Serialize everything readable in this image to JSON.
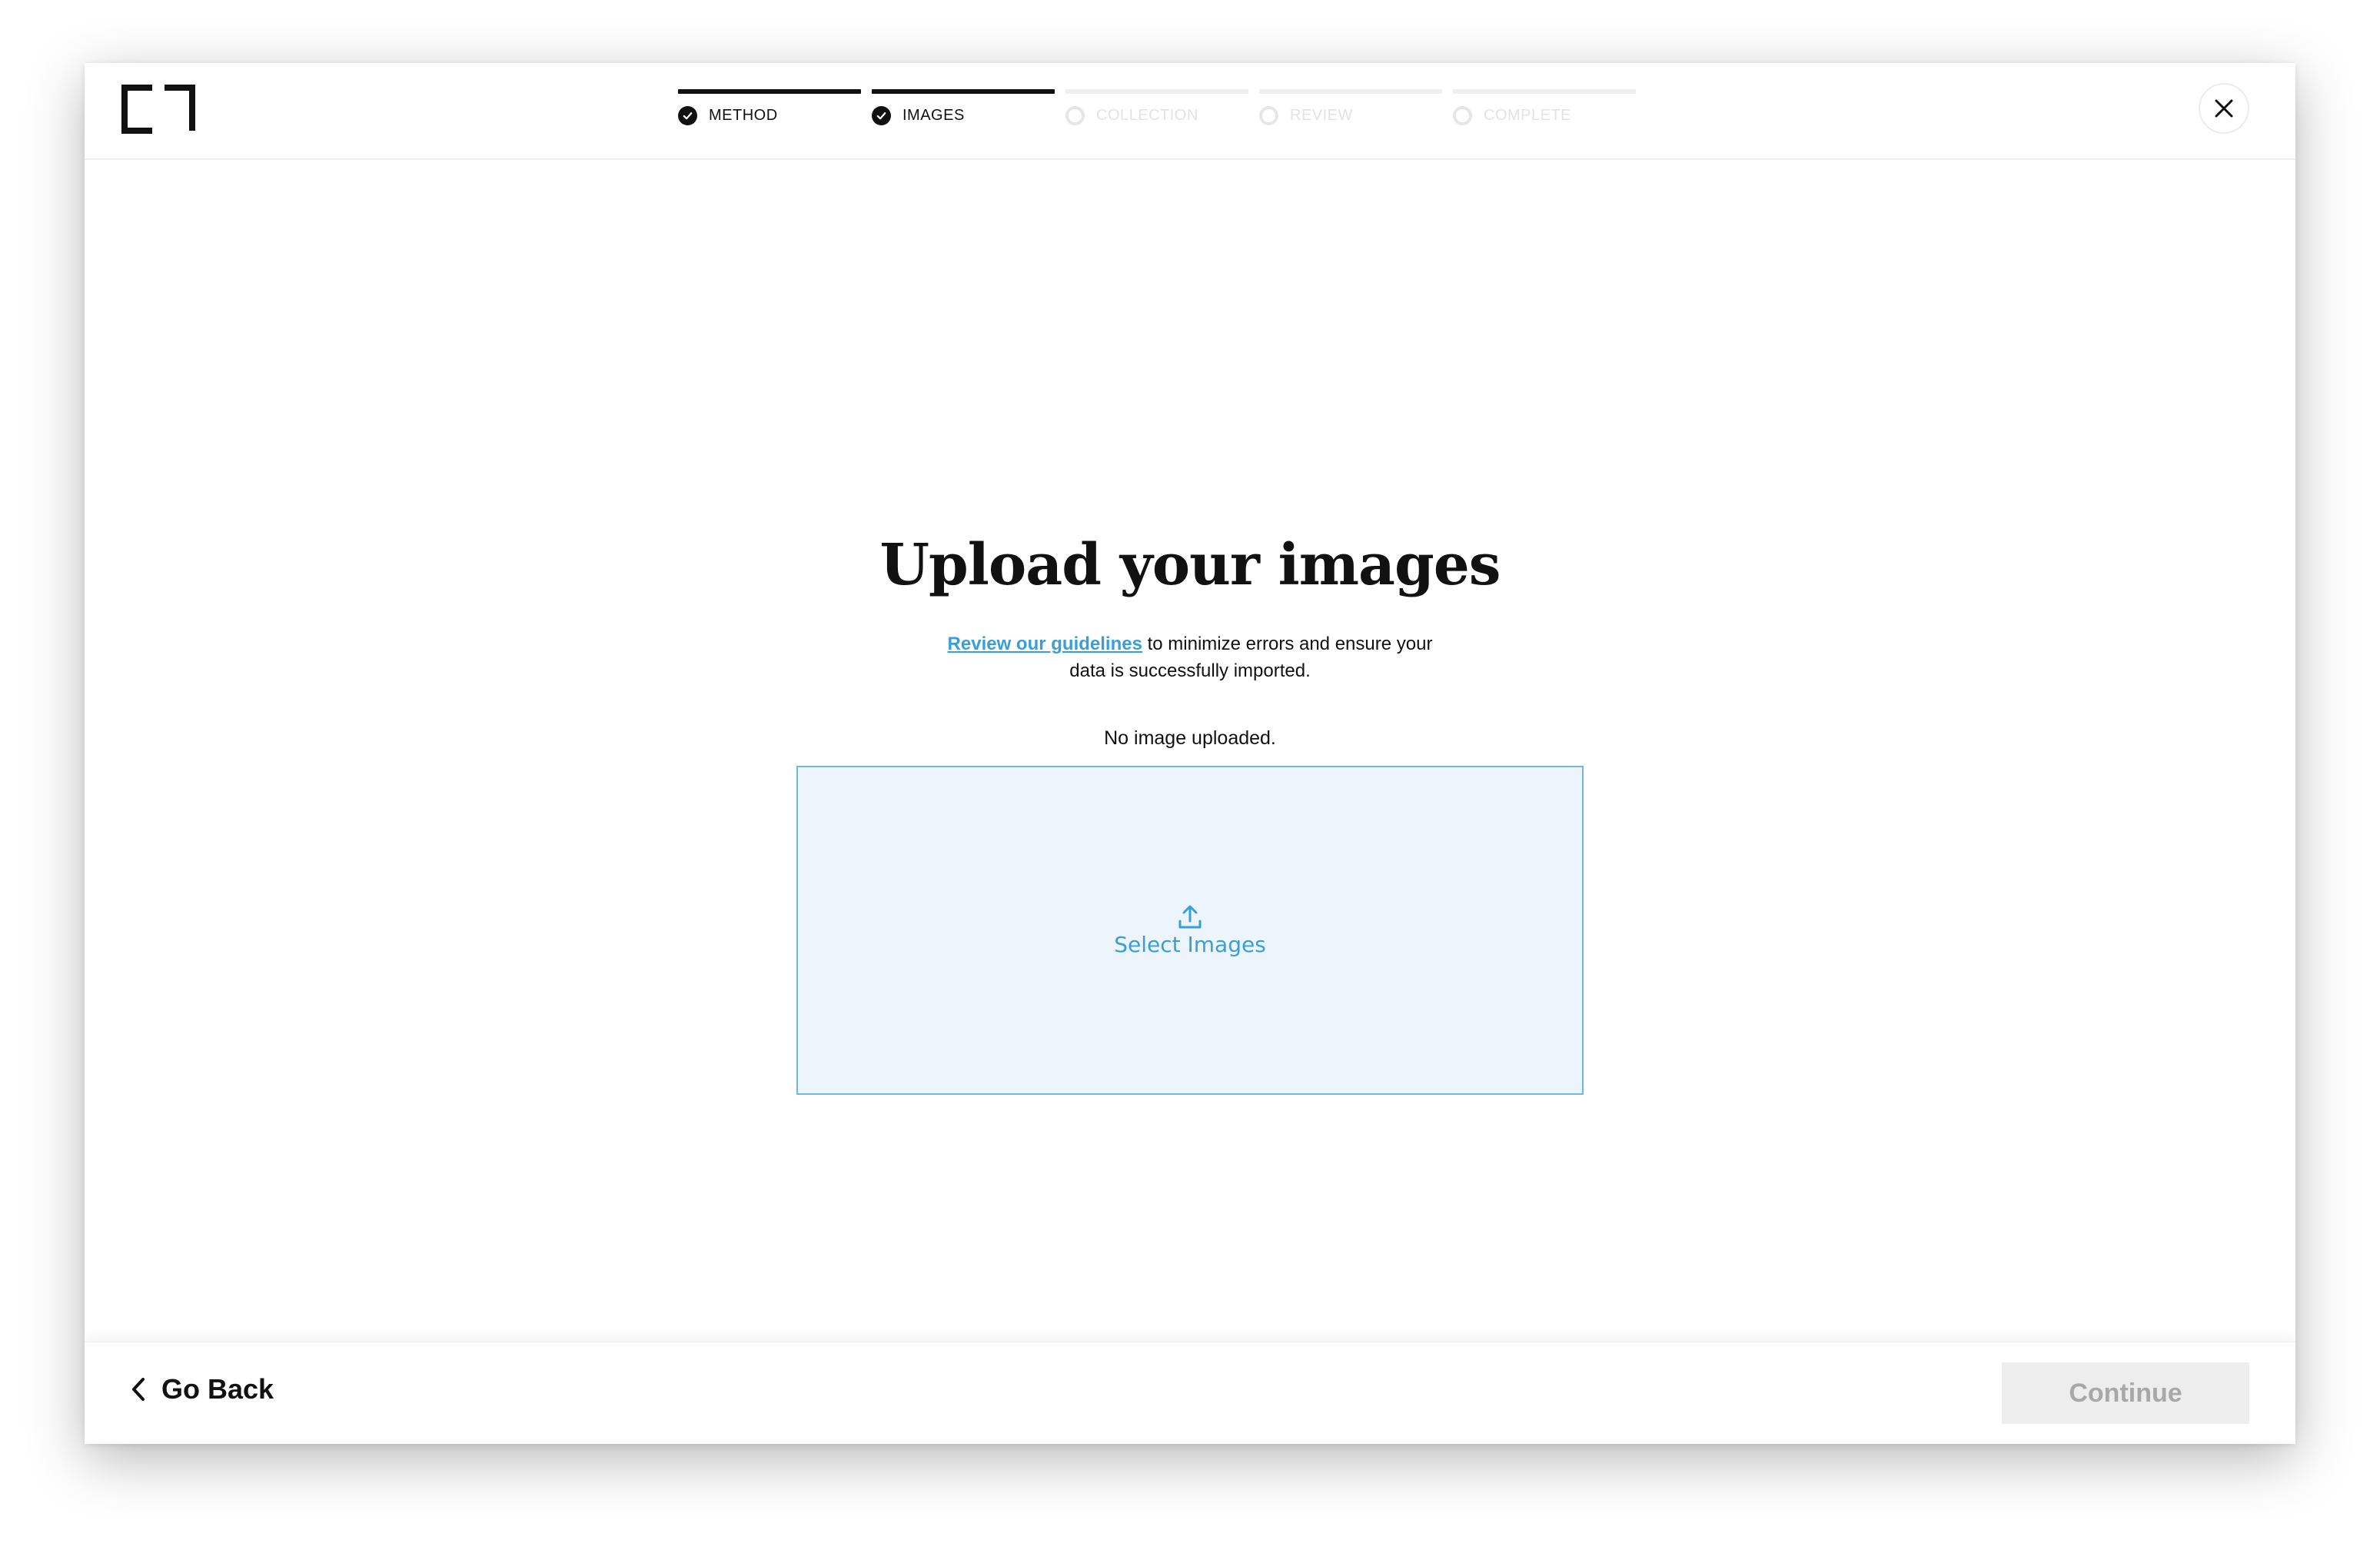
{
  "header": {
    "logo_icon": "brand-logo-icon",
    "close_icon": "close-icon",
    "steps": [
      {
        "label": "METHOD",
        "state": "complete"
      },
      {
        "label": "IMAGES",
        "state": "complete"
      },
      {
        "label": "COLLECTION",
        "state": "pending"
      },
      {
        "label": "REVIEW",
        "state": "pending"
      },
      {
        "label": "COMPLETE",
        "state": "pending"
      }
    ]
  },
  "main": {
    "title": "Upload your images",
    "guidelines_link": "Review our guidelines",
    "description_rest": " to minimize errors and ensure your data is successfully imported.",
    "status": "No image uploaded.",
    "dropzone": {
      "icon": "upload-icon",
      "label": "Select Images"
    }
  },
  "footer": {
    "back_label": "Go Back",
    "continue_label": "Continue"
  },
  "colors": {
    "accent": "#3a9fd9",
    "dropzone_bg": "#edf5fc",
    "dropzone_border": "#6fb7e6",
    "step_complete": "#111111",
    "step_pending": "#efefef",
    "disabled_button": "#ededed"
  }
}
